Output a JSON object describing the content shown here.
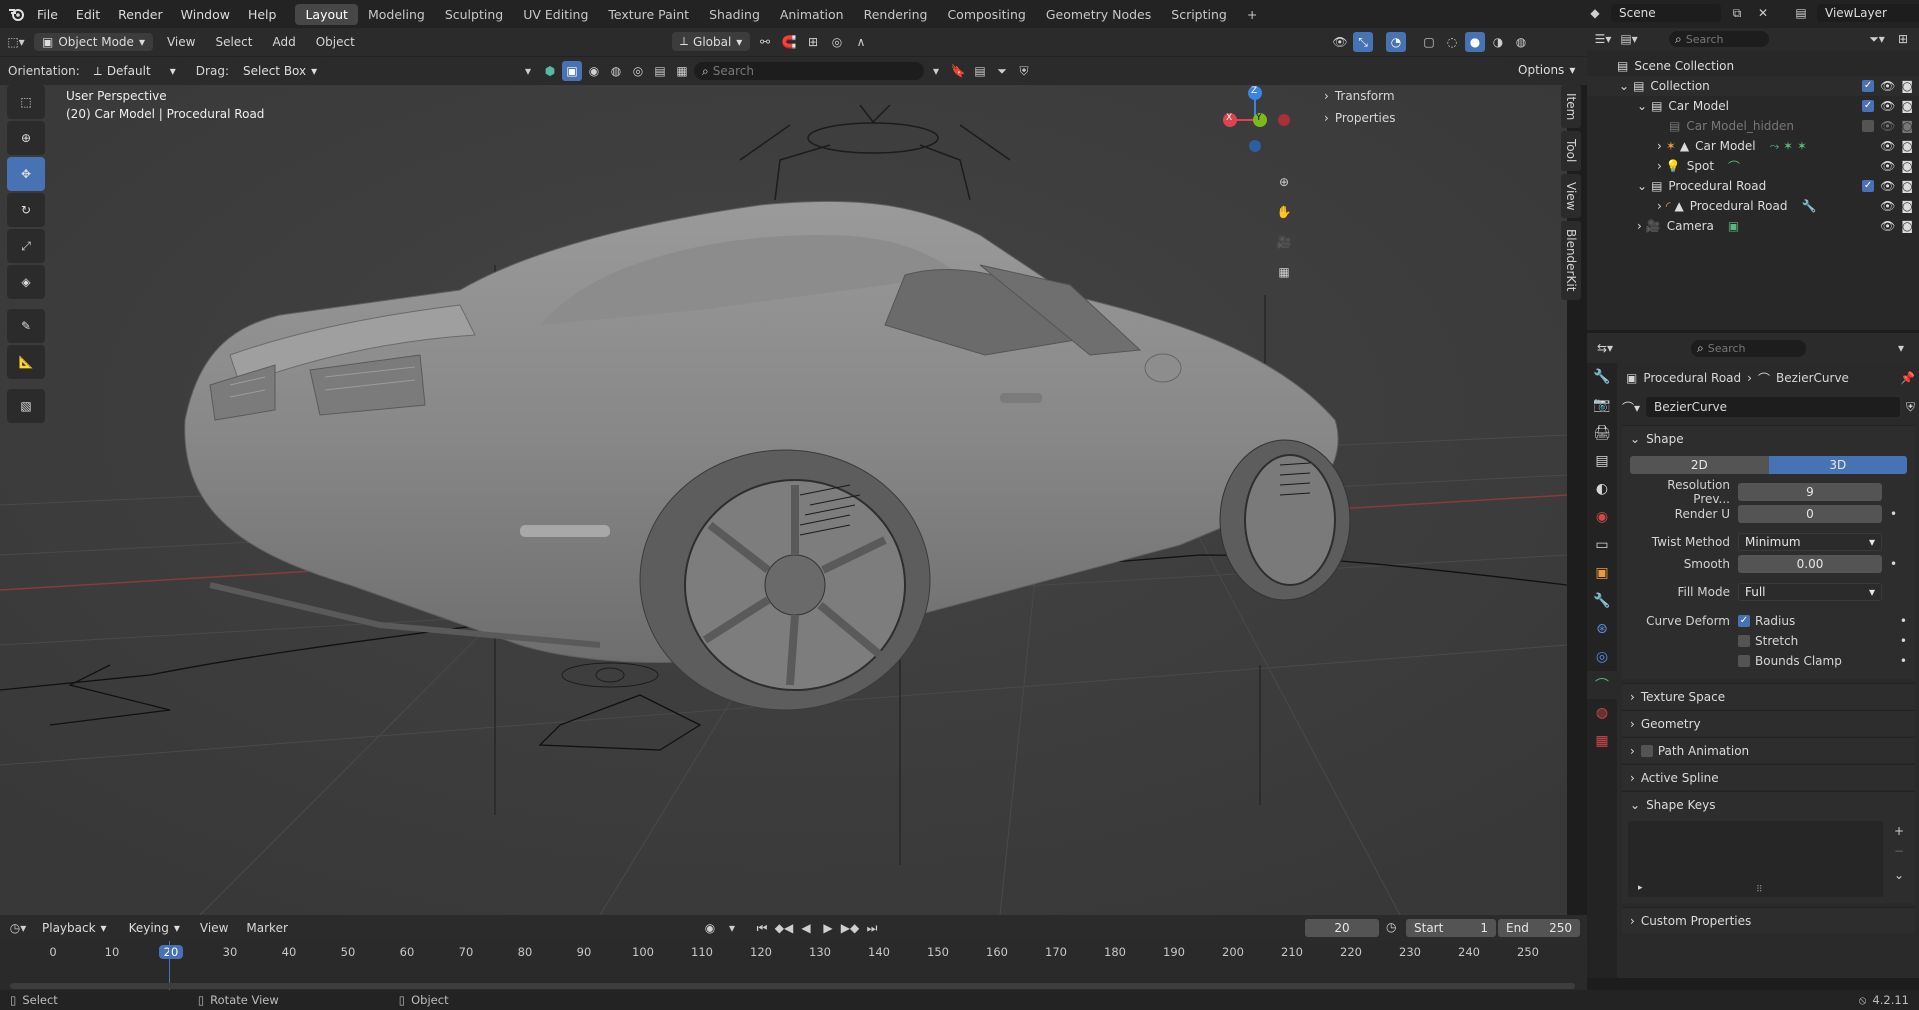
{
  "menus": [
    "File",
    "Edit",
    "Render",
    "Window",
    "Help"
  ],
  "workspaces": [
    "Layout",
    "Modeling",
    "Sculpting",
    "UV Editing",
    "Texture Paint",
    "Shading",
    "Animation",
    "Rendering",
    "Compositing",
    "Geometry Nodes",
    "Scripting"
  ],
  "active_workspace": "Layout",
  "scene_label": "Scene",
  "viewlayer_label": "ViewLayer",
  "viewport": {
    "mode": "Object Mode",
    "menus": [
      "View",
      "Select",
      "Add",
      "Object"
    ],
    "orientation_label": "Orientation:",
    "orientation_value": "Default",
    "drag_label": "Drag:",
    "drag_value": "Select Box",
    "transform_orientation": "Global",
    "search_placeholder": "Search",
    "options": "Options",
    "overlay_line1": "User Perspective",
    "overlay_line2": "(20) Car Model | Procedural Road",
    "gizmo_axes": {
      "x": "X",
      "y": "Y",
      "z": "Z"
    },
    "npanel": {
      "sections": [
        "Transform",
        "Properties"
      ],
      "tabs": [
        "Item",
        "Tool",
        "View",
        "BlenderKit"
      ]
    }
  },
  "outliner": {
    "search_placeholder": "Search",
    "rows": [
      {
        "label": "Scene Collection",
        "indent": 0
      },
      {
        "label": "Collection",
        "indent": 1
      },
      {
        "label": "Car Model",
        "indent": 2
      },
      {
        "label": "Car Model_hidden",
        "indent": 3,
        "dim": true
      },
      {
        "label": "Car Model",
        "indent": 3
      },
      {
        "label": "Spot",
        "indent": 3
      },
      {
        "label": "Procedural Road",
        "indent": 2
      },
      {
        "label": "Procedural Road",
        "indent": 3
      },
      {
        "label": "Camera",
        "indent": 2
      }
    ]
  },
  "properties": {
    "search_placeholder": "Search",
    "breadcrumb_object": "Procedural Road",
    "breadcrumb_data": "BezierCurve",
    "datablock": "BezierCurve",
    "shape_panel": "Shape",
    "dim_2d": "2D",
    "dim_3d": "3D",
    "resolution_preview_label": "Resolution Prev...",
    "resolution_preview_value": "9",
    "render_u_label": "Render U",
    "render_u_value": "0",
    "twist_method_label": "Twist Method",
    "twist_method_value": "Minimum",
    "smooth_label": "Smooth",
    "smooth_value": "0.00",
    "fill_mode_label": "Fill Mode",
    "fill_mode_value": "Full",
    "curve_deform_label": "Curve Deform",
    "radius": "Radius",
    "stretch": "Stretch",
    "bounds_clamp": "Bounds Clamp",
    "panels": [
      "Texture Space",
      "Geometry",
      "Path Animation",
      "Active Spline"
    ],
    "shape_keys": "Shape Keys",
    "custom_properties": "Custom Properties"
  },
  "timeline": {
    "menus": [
      "Playback",
      "Keying",
      "View",
      "Marker"
    ],
    "current_frame": "20",
    "start_label": "Start",
    "start_value": "1",
    "end_label": "End",
    "end_value": "250",
    "ticks": [
      "0",
      "10",
      "20",
      "30",
      "40",
      "50",
      "60",
      "70",
      "80",
      "90",
      "100",
      "110",
      "120",
      "130",
      "140",
      "150",
      "160",
      "170",
      "180",
      "190",
      "200",
      "210",
      "220",
      "230",
      "240",
      "250"
    ]
  },
  "status": {
    "select": "Select",
    "rotate": "Rotate View",
    "object": "Object",
    "version": "4.2.11"
  },
  "colors": {
    "accent": "#4772b3",
    "x_axis": "#e0434f",
    "y_axis": "#7eb91a",
    "z_axis": "#3b85e0"
  }
}
